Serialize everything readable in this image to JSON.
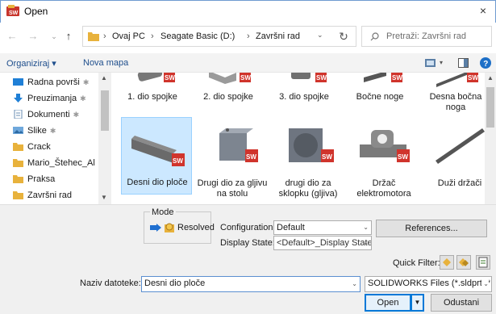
{
  "window": {
    "title": "Open",
    "close_glyph": "×"
  },
  "nav": {
    "back": "←",
    "forward": "→",
    "up": "↑"
  },
  "address": {
    "crumbs": [
      "Ovaj PC",
      "Seagate Basic (D:)",
      "Završni rad"
    ],
    "separator": "›"
  },
  "search": {
    "placeholder": "Pretraži: Završni rad"
  },
  "toolbar": {
    "organize": "Organiziraj ▾",
    "new_folder": "Nova mapa"
  },
  "sidebar": {
    "items": [
      {
        "label": "Radna površi",
        "icon": "desktop-icon",
        "pinned": true
      },
      {
        "label": "Preuzimanja",
        "icon": "download-icon",
        "pinned": true
      },
      {
        "label": "Dokumenti",
        "icon": "documents-icon",
        "pinned": true
      },
      {
        "label": "Slike",
        "icon": "pictures-icon",
        "pinned": true
      },
      {
        "label": "Crack",
        "icon": "folder-icon",
        "pinned": false
      },
      {
        "label": "Mario_Štehec_Al",
        "icon": "folder-icon",
        "pinned": false
      },
      {
        "label": "Praksa",
        "icon": "folder-icon",
        "pinned": false
      },
      {
        "label": "Završni rad",
        "icon": "folder-icon",
        "pinned": false
      }
    ]
  },
  "files": {
    "row1": [
      "1. dio spojke",
      "2. dio spojke",
      "3. dio spojke",
      "Bočne noge",
      "Desna bočna noga"
    ],
    "row2": [
      "Desni dio ploče",
      "Drugi dio za gljivu na stolu",
      "drugi dio za sklopku (gljiva)",
      "Držač elektromotora",
      "Duži držači"
    ],
    "selected": "Desni dio ploče",
    "badge": "SW"
  },
  "options": {
    "mode_label": "Mode",
    "resolved": "Resolved",
    "configuration_label": "Configuration:",
    "configuration_value": "Default",
    "display_state_label": "Display State:",
    "display_state_value": "<Default>_Display State",
    "references_button": "References...",
    "quick_filter_label": "Quick Filter:"
  },
  "footer": {
    "filename_label": "Naziv datoteke:",
    "filename_value": "Desni dio ploče",
    "filetype_value": "SOLIDWORKS Files (*.sldprt; *.sl",
    "open_button": "Open",
    "cancel_button": "Odustani"
  },
  "colors": {
    "accent": "#0078d7",
    "selection": "#cce8ff",
    "folder": "#e8b23c",
    "sw_badge": "#d0342c"
  }
}
